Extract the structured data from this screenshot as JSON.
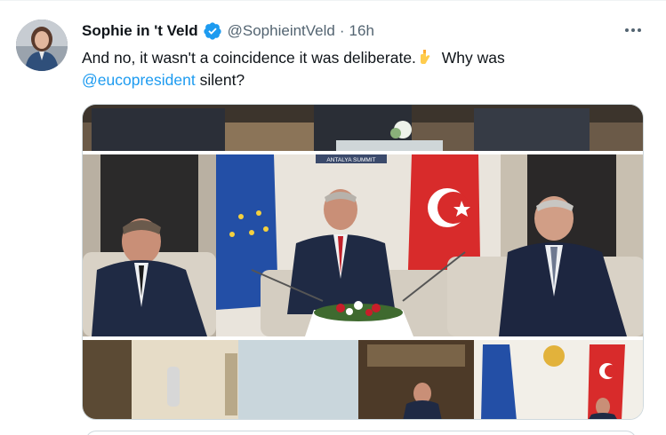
{
  "tweet": {
    "display_name": "Sophie in 't Veld",
    "handle": "@SophieintVeld",
    "separator": "·",
    "time": "16h",
    "text_before": "And no, it wasn't a coincidence it was deliberate.",
    "text_middle": " Why was",
    "mention": "@eucopresident",
    "text_after": " silent?",
    "emoji": "pointing-down-hand-icon",
    "photo_label": "ANTALYA SUMMIT"
  },
  "colors": {
    "accent": "#1d9bf0",
    "text": "#0f1419",
    "muted": "#536471",
    "border": "#cfd9de"
  }
}
